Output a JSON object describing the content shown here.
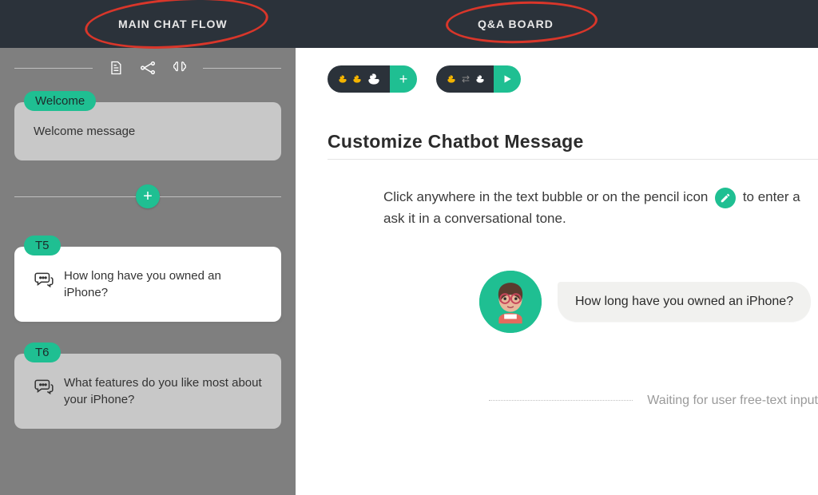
{
  "nav": {
    "main_tab": "MAIN CHAT FLOW",
    "qa_tab": "Q&A BOARD"
  },
  "sidebar": {
    "icons": [
      "document-icon",
      "flow-icon",
      "brain-icon"
    ],
    "cards": [
      {
        "chip": "Welcome",
        "text": "Welcome message",
        "active": false,
        "has_icon": false
      },
      {
        "chip": "T5",
        "text": "How long have you owned an iPhone?",
        "active": true,
        "has_icon": true
      },
      {
        "chip": "T6",
        "text": "What features do you like most about your iPhone?",
        "active": false,
        "has_icon": true
      }
    ],
    "add_label": "+"
  },
  "toolbar": {
    "group_add_label": "+",
    "group_play_label": "▶"
  },
  "editor": {
    "title": "Customize Chatbot Message",
    "help_before": "Click anywhere in the text bubble or on the pencil icon",
    "help_after": "to enter a ask it in a conversational tone.",
    "bubble_text": "How long have you owned an iPhone?",
    "waiting_text": "Waiting for user free-text input"
  },
  "colors": {
    "accent": "#1fbf92",
    "bar": "#2b323a",
    "sidebar": "#7f7f7f"
  }
}
